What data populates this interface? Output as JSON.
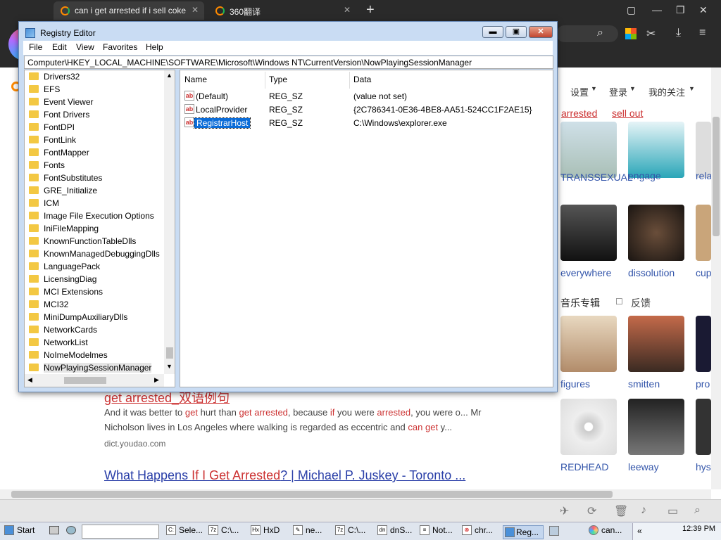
{
  "browser": {
    "tabs": [
      {
        "label": "can i get arrested if i sell coke"
      },
      {
        "label": "360翻译"
      }
    ],
    "new_tab": "+",
    "window_controls": [
      "▢",
      "—",
      "❐",
      "✕"
    ]
  },
  "page": {
    "nav": [
      "设置",
      "登录",
      "我的关注"
    ],
    "related_links": [
      "arrested",
      "sell out"
    ],
    "thumbs_row1": [
      "TRANSSEXUAL",
      "engage",
      "rela"
    ],
    "thumbs_row2": [
      "everywhere",
      "dissolution",
      "cup"
    ],
    "music_title": "音乐专辑",
    "feedback": "反馈",
    "thumbs_row3": [
      "figures",
      "smitten",
      "pro"
    ],
    "thumbs_row4": [
      "REDHEAD",
      "leeway",
      "hys"
    ],
    "result1_title": "get arrested_双语例句",
    "result1_snip_parts": [
      "And it was better to ",
      "get",
      " hurt than ",
      "get arrested",
      ", because ",
      "if",
      " you were ",
      "arrested",
      ", you were o... Mr"
    ],
    "result1_snip2_parts": [
      "Nicholson lives in Los Angeles where walking is regarded as eccentric and ",
      "can get",
      " y..."
    ],
    "result1_source": "dict.youdao.com",
    "result2_parts": [
      "What Happens ",
      "If I Get Arrested",
      "? | Michael P. Juskey - Toronto ..."
    ]
  },
  "regedit": {
    "title": "Registry Editor",
    "menu": [
      "File",
      "Edit",
      "View",
      "Favorites",
      "Help"
    ],
    "address": "Computer\\HKEY_LOCAL_MACHINE\\SOFTWARE\\Microsoft\\Windows NT\\CurrentVersion\\NowPlayingSessionManager",
    "tree": [
      "Drivers32",
      "EFS",
      "Event Viewer",
      "Font Drivers",
      "FontDPI",
      "FontLink",
      "FontMapper",
      "Fonts",
      "FontSubstitutes",
      "GRE_Initialize",
      "ICM",
      "Image File Execution Options",
      "IniFileMapping",
      "KnownFunctionTableDlls",
      "KnownManagedDebuggingDlls",
      "LanguagePack",
      "LicensingDiag",
      "MCI Extensions",
      "MCI32",
      "MiniDumpAuxiliaryDlls",
      "NetworkCards",
      "NetworkList",
      "NoImeModelmes",
      "NowPlayingSessionManager"
    ],
    "columns": [
      "Name",
      "Type",
      "Data"
    ],
    "values": [
      {
        "name": "(Default)",
        "type": "REG_SZ",
        "data": "(value not set)"
      },
      {
        "name": "LocalProvider",
        "type": "REG_SZ",
        "data": "{2C786341-0E36-4BE8-AA51-524CC1F2AE15}"
      },
      {
        "name": "RegistrarHost",
        "type": "REG_SZ",
        "data": "C:\\Windows\\explorer.exe"
      }
    ]
  },
  "taskbar": {
    "start": "Start",
    "items": [
      "Sele...",
      "C:\\...",
      "HxD",
      "ne...",
      "C:\\...",
      "dnS...",
      "Not...",
      "chr...",
      "Reg...",
      "can..."
    ],
    "clock": "12:39 PM"
  }
}
